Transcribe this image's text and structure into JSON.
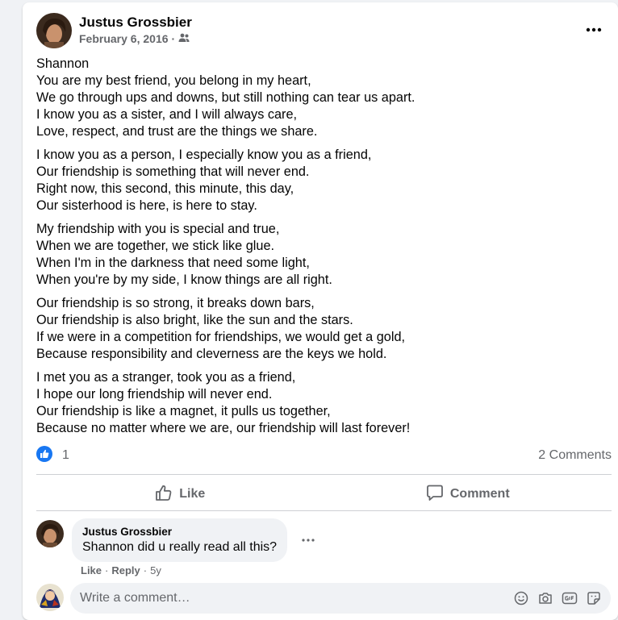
{
  "post": {
    "author": "Justus Grossbier",
    "date": "February 6, 2016",
    "separator": "·",
    "audience_icon": "friends-icon",
    "stanzas": [
      [
        "Shannon",
        "You are my best friend, you belong in my heart,",
        "We go through ups and downs, but still nothing can tear us apart.",
        "I know you as a sister, and I will always care,",
        "Love, respect, and trust are the things we share."
      ],
      [
        "I know you as a person, I especially know you as a friend,",
        "Our friendship is something that will never end.",
        "Right now, this second, this minute, this day,",
        "Our sisterhood is here, is here to stay."
      ],
      [
        "My friendship with you is special and true,",
        "When we are together, we stick like glue.",
        "When I'm in the darkness that need some light,",
        "When you're by my side, I know things are all right."
      ],
      [
        "Our friendship is so strong, it breaks down bars,",
        "Our friendship is also bright, like the sun and the stars.",
        "If we were in a competition for friendships, we would get a gold,",
        "Because responsibility and cleverness are the keys we hold."
      ],
      [
        "I met you as a stranger, took you as a friend,",
        "I hope our long friendship will never end.",
        "Our friendship is like a magnet, it pulls us together,",
        "Because no matter where we are, our friendship will last forever!"
      ]
    ]
  },
  "reactions": {
    "count": "1",
    "comments": "2 Comments"
  },
  "actions": {
    "like": "Like",
    "comment": "Comment"
  },
  "comment": {
    "author": "Justus Grossbier",
    "text": "Shannon did u really read all this?",
    "like": "Like",
    "reply": "Reply",
    "dot": "·",
    "age": "5y"
  },
  "composer": {
    "placeholder": "Write a comment…",
    "icons": [
      "emoji-icon",
      "camera-icon",
      "gif-icon",
      "sticker-icon"
    ]
  },
  "colors": {
    "like_blue": "#1877f2",
    "secondary_text": "#65676b",
    "bubble_bg": "#f0f2f5"
  }
}
